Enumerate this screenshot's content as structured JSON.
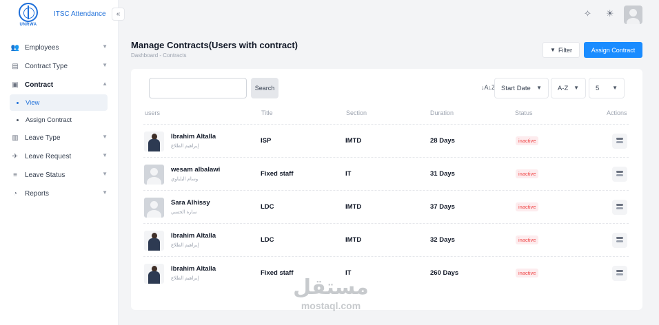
{
  "app": {
    "logo_text": "UNRWA",
    "title": "ITSC Attendance"
  },
  "sidebar": {
    "items": [
      {
        "label": "Employees",
        "icon": "users-icon"
      },
      {
        "label": "Contract Type",
        "icon": "document-icon"
      },
      {
        "label": "Contract",
        "icon": "contract-icon",
        "open": true
      },
      {
        "label": "Leave Type",
        "icon": "book-icon"
      },
      {
        "label": "Leave Request",
        "icon": "plane-icon"
      },
      {
        "label": "Leave Status",
        "icon": "list-icon"
      },
      {
        "label": "Reports",
        "icon": "pie-chart-icon"
      }
    ],
    "contract_sub": [
      {
        "label": "View",
        "active": true
      },
      {
        "label": "Assign Contract"
      }
    ]
  },
  "header": {
    "title": "Manage Contracts(Users with contract)",
    "breadcrumb": "Dashboard  -  Contracts",
    "filter_label": "Filter",
    "assign_label": "Assign Contract"
  },
  "toolbar": {
    "search_button": "Search",
    "search_value": "",
    "sort_field": "Start Date",
    "sort_order": "A-Z",
    "page_size": "5"
  },
  "table": {
    "columns": [
      "users",
      "Title",
      "Section",
      "Duration",
      "Status",
      "Actions"
    ],
    "rows": [
      {
        "name": "Ibrahim Altalla",
        "arabic": "إبراهيم الطلاع",
        "title": "ISP",
        "section": "IMTD",
        "duration": "28 Days",
        "status": "inactive",
        "photo": true
      },
      {
        "name": "wesam albalawi",
        "arabic": "وسام البلباوي",
        "title": "Fixed staff",
        "section": "IT",
        "duration": "31 Days",
        "status": "inactive",
        "photo": false
      },
      {
        "name": "Sara Alhissy",
        "arabic": "سارة الحسي",
        "title": "LDC",
        "section": "IMTD",
        "duration": "37 Days",
        "status": "inactive",
        "photo": false
      },
      {
        "name": "Ibrahim Altalla",
        "arabic": "إبراهيم الطلاع",
        "title": "LDC",
        "section": "IMTD",
        "duration": "32 Days",
        "status": "inactive",
        "photo": true
      },
      {
        "name": "Ibrahim Altalla",
        "arabic": "إبراهيم الطلاع",
        "title": "Fixed staff",
        "section": "IT",
        "duration": "260 Days",
        "status": "inactive",
        "photo": true
      }
    ]
  },
  "watermark": {
    "arabic": "مستقل",
    "latin": "mostaql.com"
  },
  "colors": {
    "accent": "#1a8cff",
    "brand": "#1e6fd9",
    "inactive": "#ef4444"
  }
}
